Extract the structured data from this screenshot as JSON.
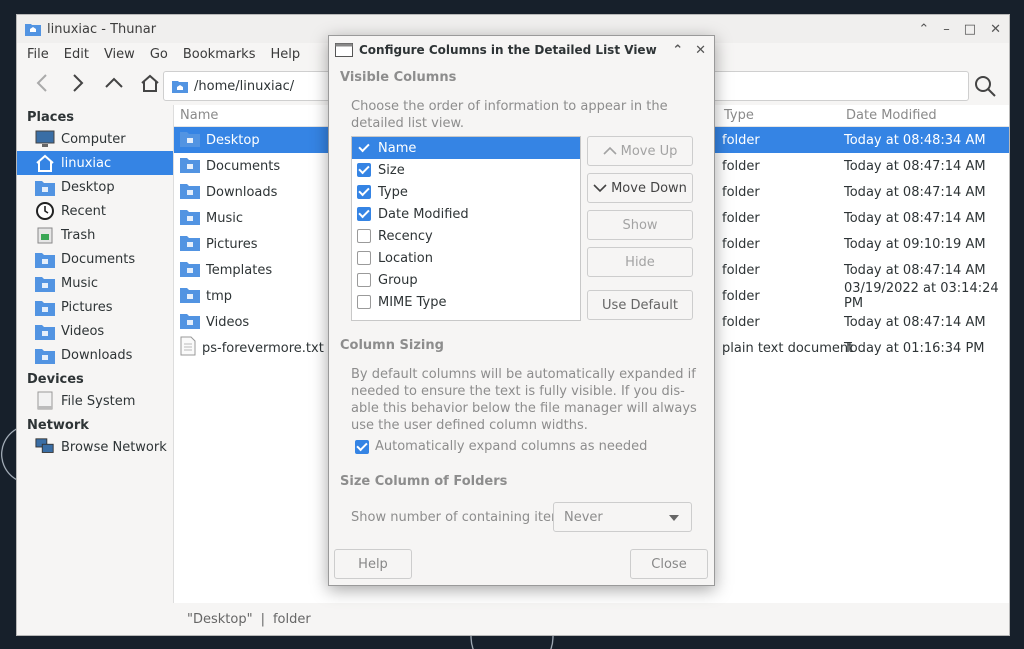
{
  "window": {
    "title": "linuxiac - Thunar",
    "menu": [
      "File",
      "Edit",
      "View",
      "Go",
      "Bookmarks",
      "Help"
    ],
    "path": "/home/linuxiac/"
  },
  "sidebar": {
    "places_heading": "Places",
    "places": [
      {
        "label": "Computer",
        "icon": "computer-icon"
      },
      {
        "label": "linuxiac",
        "icon": "home-icon",
        "selected": true
      },
      {
        "label": "Desktop",
        "icon": "desktop-folder-icon"
      },
      {
        "label": "Recent",
        "icon": "clock-icon"
      },
      {
        "label": "Trash",
        "icon": "trash-icon"
      },
      {
        "label": "Documents",
        "icon": "documents-folder-icon"
      },
      {
        "label": "Music",
        "icon": "music-folder-icon"
      },
      {
        "label": "Pictures",
        "icon": "pictures-folder-icon"
      },
      {
        "label": "Videos",
        "icon": "videos-folder-icon"
      },
      {
        "label": "Downloads",
        "icon": "downloads-folder-icon"
      }
    ],
    "devices_heading": "Devices",
    "devices": [
      {
        "label": "File System",
        "icon": "drive-icon"
      }
    ],
    "network_heading": "Network",
    "network": [
      {
        "label": "Browse Network",
        "icon": "network-icon"
      }
    ]
  },
  "filelist": {
    "headers": {
      "name": "Name",
      "type": "Type",
      "date": "Date Modified"
    },
    "rows": [
      {
        "name": "Desktop",
        "type": "folder",
        "date": "Today at 08:48:34 AM",
        "selected": true
      },
      {
        "name": "Documents",
        "type": "folder",
        "date": "Today at 08:47:14 AM"
      },
      {
        "name": "Downloads",
        "type": "folder",
        "date": "Today at 08:47:14 AM"
      },
      {
        "name": "Music",
        "type": "folder",
        "date": "Today at 08:47:14 AM"
      },
      {
        "name": "Pictures",
        "type": "folder",
        "date": "Today at 09:10:19 AM"
      },
      {
        "name": "Templates",
        "type": "folder",
        "date": "Today at 08:47:14 AM"
      },
      {
        "name": "tmp",
        "type": "folder",
        "date": "03/19/2022 at 03:14:24 PM"
      },
      {
        "name": "Videos",
        "type": "folder",
        "date": "Today at 08:47:14 AM"
      },
      {
        "name": "ps-forevermore.txt",
        "type": "plain text document",
        "date": "Today at 01:16:34 PM",
        "file": true
      }
    ]
  },
  "statusbar": {
    "name": "\"Desktop\"",
    "sep": "|",
    "type": "folder"
  },
  "dialog": {
    "title": "Configure Columns in the Detailed List View",
    "visible_heading": "Visible Columns",
    "visible_desc_1": "Choose the order of information to appear in the",
    "visible_desc_2": "detailed list view.",
    "columns": [
      {
        "label": "Name",
        "checked": true,
        "selected": true
      },
      {
        "label": "Size",
        "checked": true
      },
      {
        "label": "Type",
        "checked": true
      },
      {
        "label": "Date Modified",
        "checked": true
      },
      {
        "label": "Recency",
        "checked": false
      },
      {
        "label": "Location",
        "checked": false
      },
      {
        "label": "Group",
        "checked": false
      },
      {
        "label": "MIME Type",
        "checked": false
      }
    ],
    "buttons": {
      "move_up": "Move Up",
      "move_down": "Move Down",
      "show": "Show",
      "hide": "Hide",
      "use_default": "Use Default"
    },
    "sizing_heading": "Column Sizing",
    "sizing_desc": [
      "By default columns will be automatically expanded if",
      "needed to ensure the text is fully visible. If you dis-",
      "able this behavior below the file manager will always",
      "use the user defined column widths."
    ],
    "auto_expand_label": "Automatically expand columns as needed",
    "folder_heading": "Size Column of Folders",
    "folder_label": "Show number of containing items",
    "folder_value": "Never",
    "help": "Help",
    "close": "Close"
  },
  "colors": {
    "accent": "#3584e4",
    "folder": "#5294e2"
  }
}
